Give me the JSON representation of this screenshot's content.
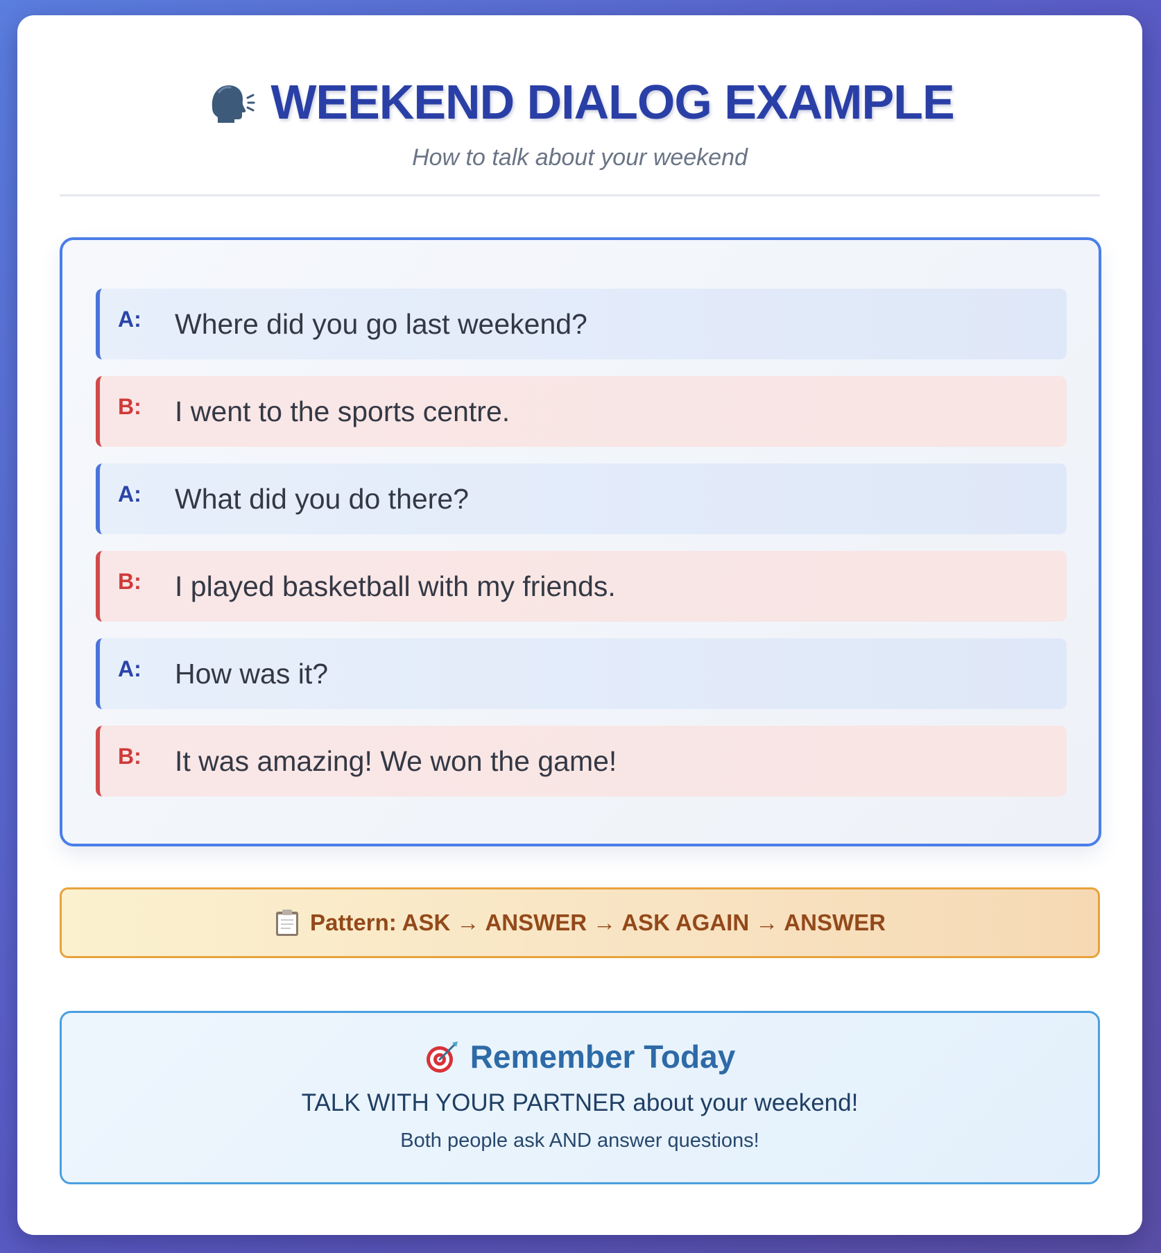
{
  "header": {
    "icon": "speaking-head-icon",
    "title": "WEEKEND DIALOG EXAMPLE",
    "subtitle": "How to talk about your weekend"
  },
  "dialog": {
    "lines": [
      {
        "speaker": "A:",
        "text": "Where did you go last weekend?"
      },
      {
        "speaker": "B:",
        "text": "I went to the sports centre."
      },
      {
        "speaker": "A:",
        "text": "What did you do there?"
      },
      {
        "speaker": "B:",
        "text": "I played basketball with my friends."
      },
      {
        "speaker": "A:",
        "text": "How was it?"
      },
      {
        "speaker": "B:",
        "text": "It was amazing! We won the game!"
      }
    ]
  },
  "pattern": {
    "icon": "clipboard-icon",
    "text": "Pattern: ASK → ANSWER → ASK AGAIN → ANSWER"
  },
  "remember": {
    "icon": "target-icon",
    "title": "Remember Today",
    "main": "TALK WITH YOUR PARTNER about your weekend!",
    "sub": "Both people ask AND answer questions!"
  },
  "colors": {
    "title": "#2a3fa6",
    "speaker_a": "#4a74da",
    "speaker_b": "#d24a4a",
    "dialog_border": "#4a7ee8",
    "pattern_border": "#e8a23c",
    "remember_border": "#4a9fe0",
    "background_gradient_start": "#5b7fe0",
    "background_gradient_end": "#5b4fa6"
  }
}
